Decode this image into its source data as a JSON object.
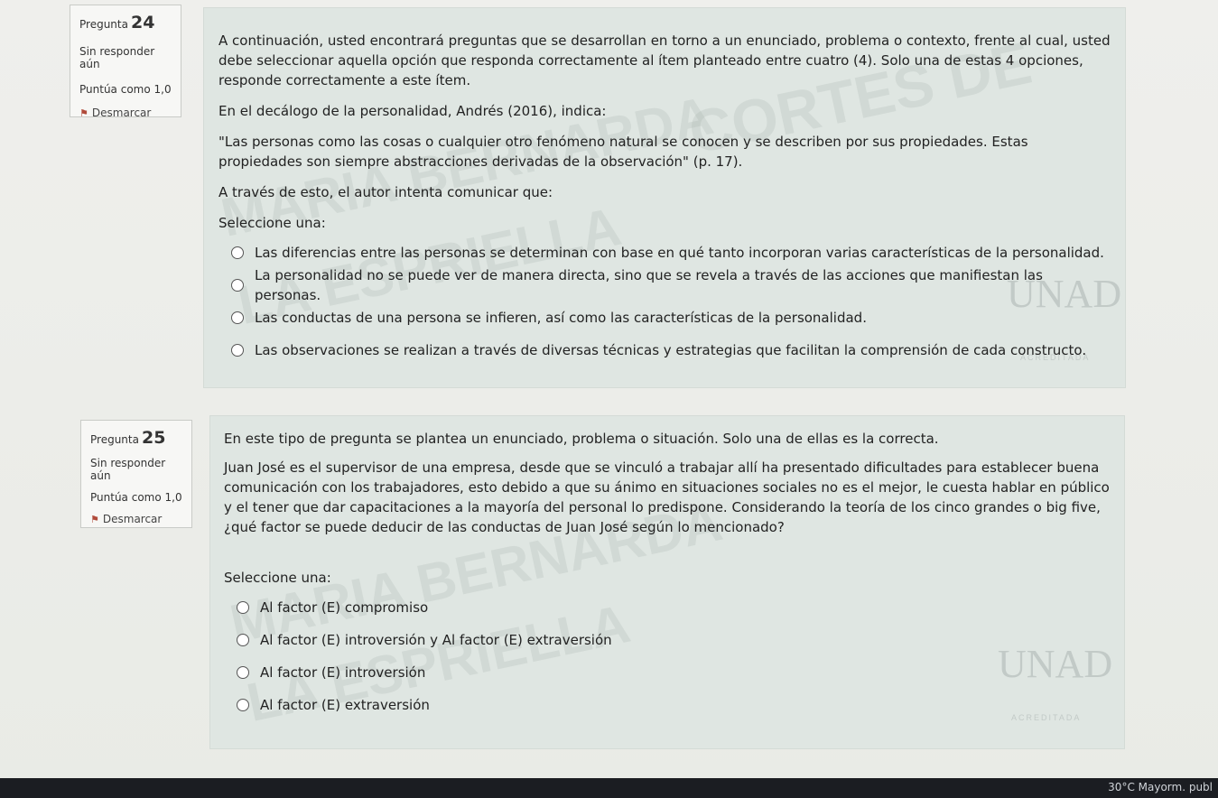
{
  "q24": {
    "label": "Pregunta",
    "number": "24",
    "status": "Sin responder aún",
    "points": "Puntúa como 1,0",
    "flag": "Desmarcar",
    "intro": "A continuación, usted encontrará preguntas que se desarrollan en torno a un enunciado, problema o contexto, frente al cual, usted debe seleccionar aquella opción que responda correctamente al ítem planteado entre cuatro (4). Solo una de estas 4 opciones, responde correctamente a este ítem.",
    "p2": "En el decálogo de la personalidad, Andrés (2016), indica:",
    "p3": "\"Las personas como las cosas o cualquier otro fenómeno natural se conocen y se describen por sus propiedades. Estas propiedades son siempre abstracciones derivadas de la observación\" (p. 17).",
    "p4": "A través de esto, el autor intenta comunicar que:",
    "prompt": "Seleccione una:",
    "options": [
      "Las diferencias entre las personas se determinan con base en qué tanto incorporan varias características de la personalidad.",
      "La personalidad no se puede ver de manera directa, sino que se revela a través de las acciones que manifiestan las personas.",
      "Las conductas de una persona se infieren, así como las características de la personalidad.",
      "Las observaciones se realizan a través de diversas técnicas y estrategias que facilitan la comprensión de cada constructo."
    ]
  },
  "q25": {
    "label": "Pregunta",
    "number": "25",
    "status": "Sin responder aún",
    "points": "Puntúa como 1,0",
    "flag": "Desmarcar",
    "intro": "En este tipo de pregunta se plantea un enunciado, problema o situación. Solo una de ellas es la correcta.",
    "p2": "Juan José es el supervisor de una empresa, desde que se vinculó a trabajar allí ha presentado dificultades para establecer buena comunicación con los trabajadores, esto debido a que su ánimo en situaciones sociales no es el mejor, le cuesta hablar en público y el tener que dar capacitaciones a la mayoría del personal lo predispone. Considerando la teoría de los cinco grandes o big five, ¿qué factor se puede deducir de las conductas de Juan José según lo mencionado?",
    "prompt": "Seleccione una:",
    "options": [
      "Al factor (E) compromiso",
      "Al factor (E) introversión y Al factor (E) extraversión",
      "Al factor (E) introversión",
      "Al factor (E) extraversión"
    ]
  },
  "watermark": {
    "line1": "CORTES DE",
    "line2": "MARIA BERNARDA",
    "line3": "LA ESPRIELLA",
    "logo": "UNAD",
    "logo_sub": "ACREDITADA"
  },
  "taskbar": {
    "weather": "30°C  Mayorm. publ"
  }
}
